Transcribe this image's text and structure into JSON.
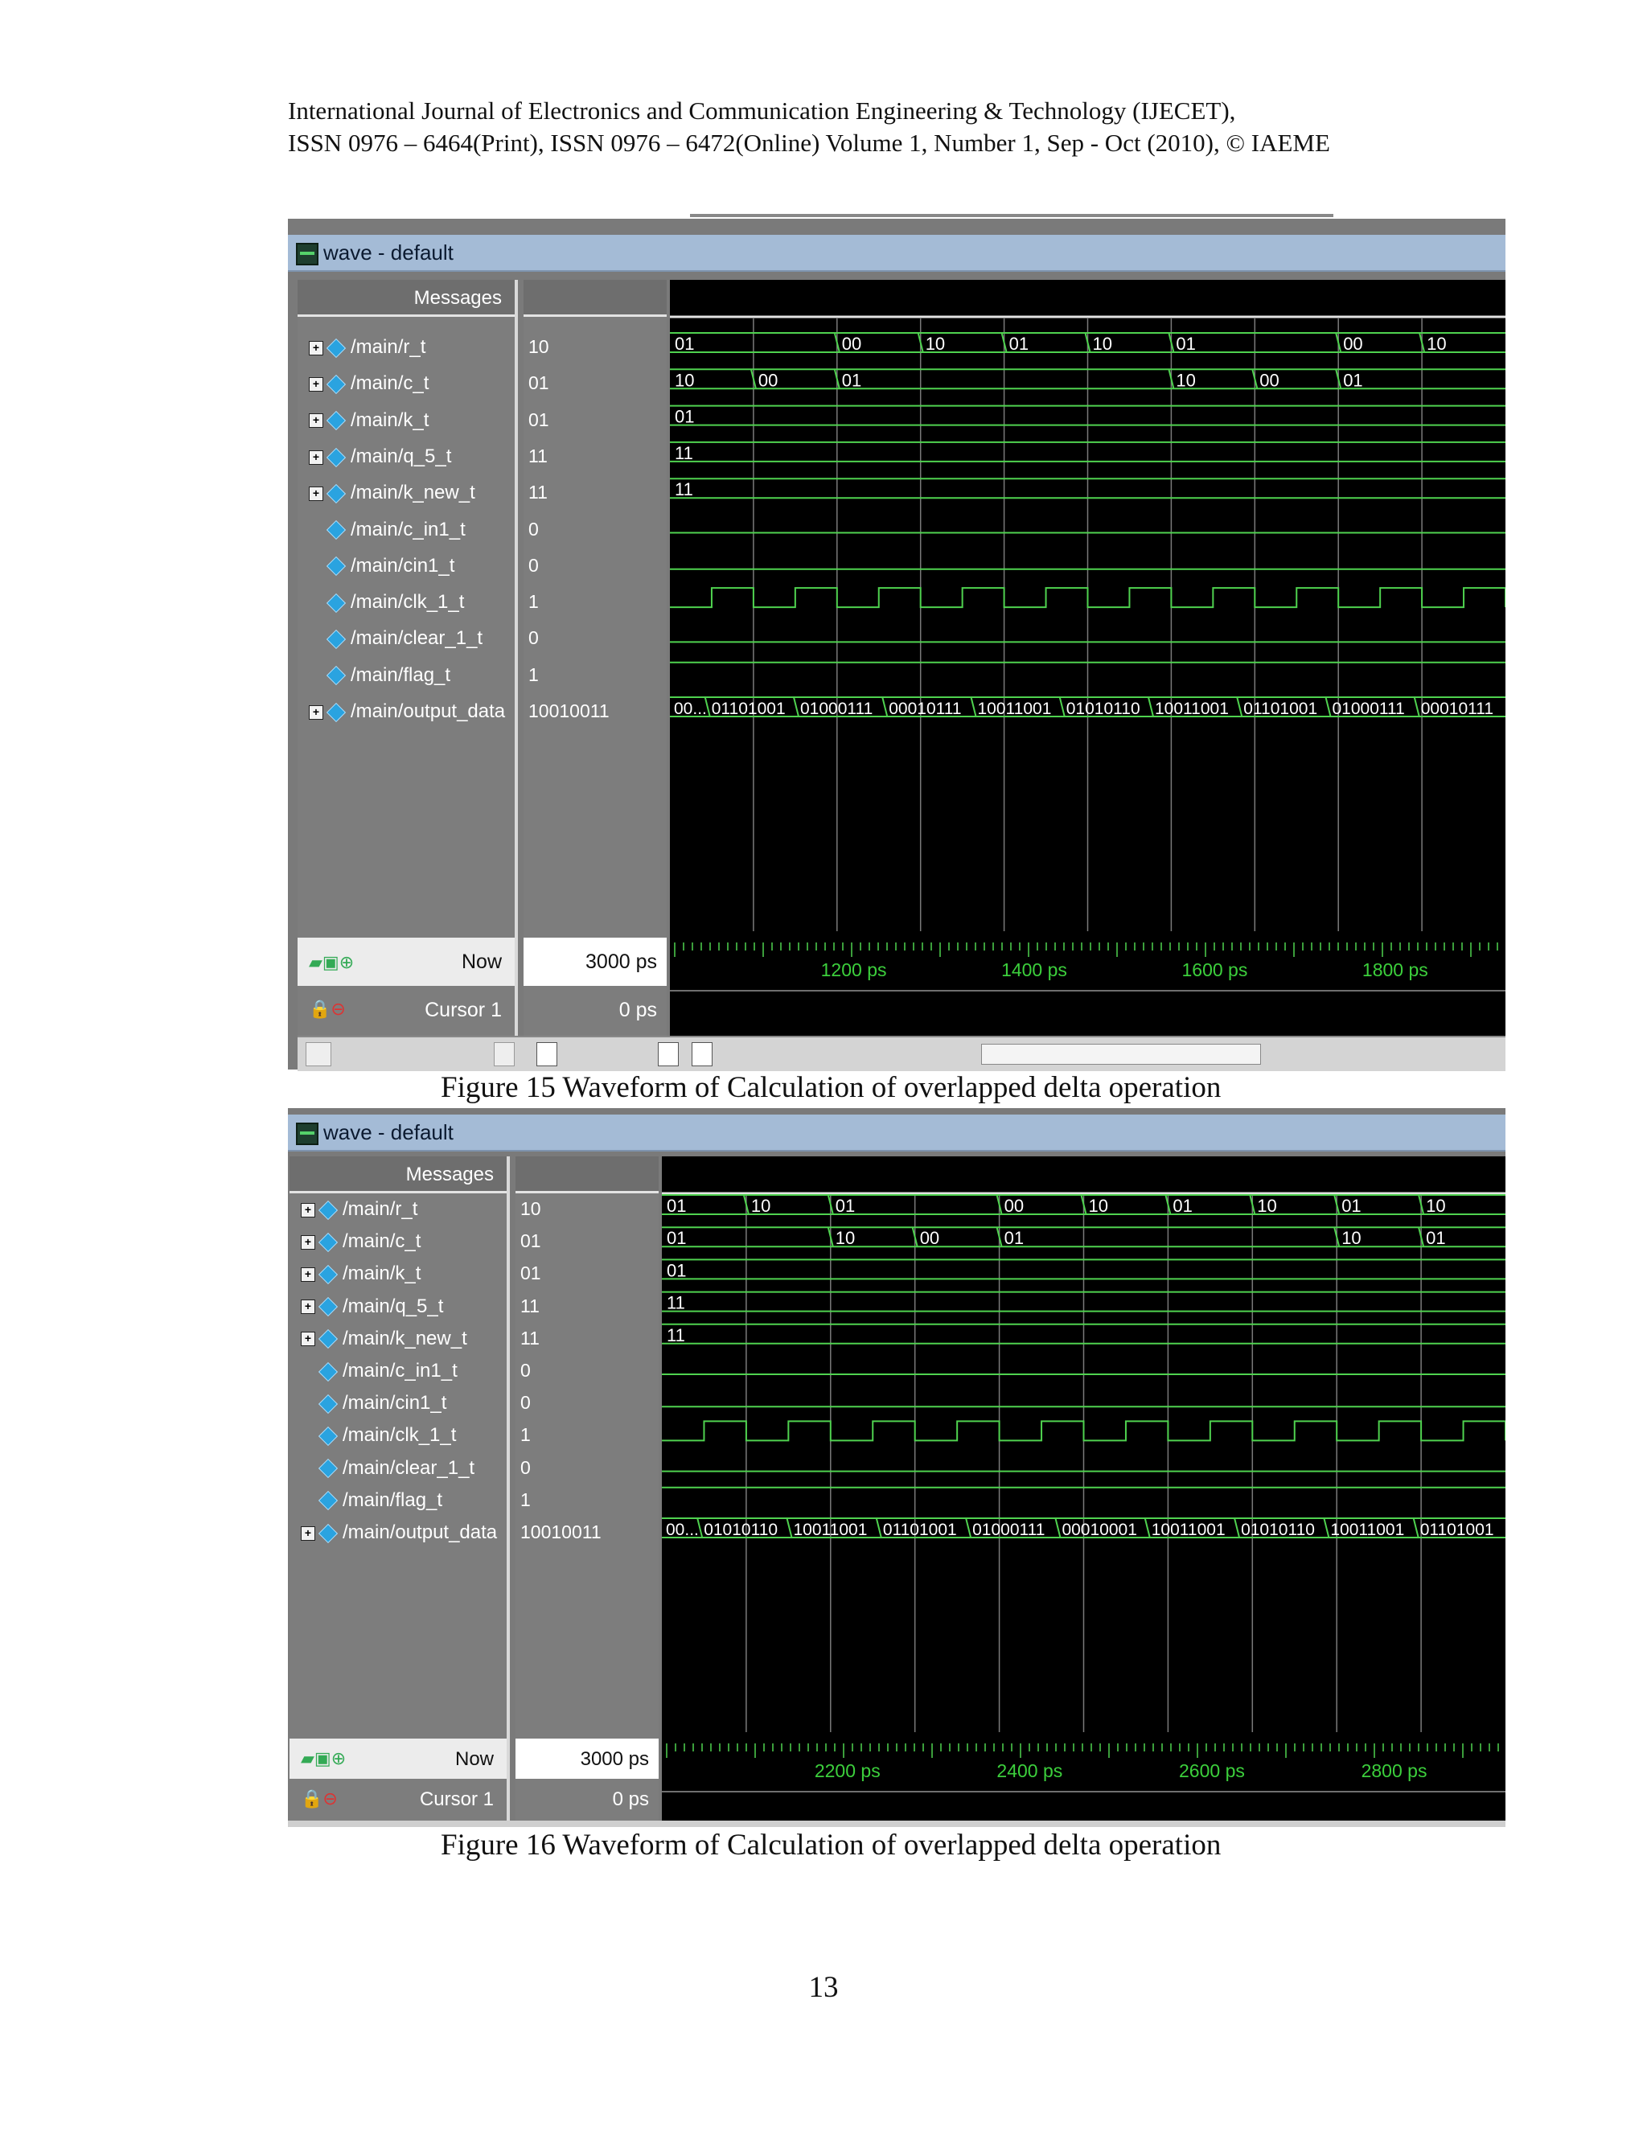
{
  "header": {
    "line1": "International Journal of Electronics and Communication Engineering & Technology (IJECET),",
    "line2": "ISSN 0976 – 6464(Print), ISSN 0976 – 6472(Online) Volume 1, Number 1, Sep - Oct (2010), © IAEME"
  },
  "figures": [
    {
      "window_title": "wave - default",
      "messages_label": "Messages",
      "signals": [
        {
          "name": "/main/r_t",
          "value": "10",
          "expandable": true
        },
        {
          "name": "/main/c_t",
          "value": "01",
          "expandable": true
        },
        {
          "name": "/main/k_t",
          "value": "01",
          "expandable": true
        },
        {
          "name": "/main/q_5_t",
          "value": "11",
          "expandable": true
        },
        {
          "name": "/main/k_new_t",
          "value": "11",
          "expandable": true
        },
        {
          "name": "/main/c_in1_t",
          "value": "0",
          "expandable": false
        },
        {
          "name": "/main/cin1_t",
          "value": "0",
          "expandable": false
        },
        {
          "name": "/main/clk_1_t",
          "value": "1",
          "expandable": false
        },
        {
          "name": "/main/clear_1_t",
          "value": "0",
          "expandable": false
        },
        {
          "name": "/main/flag_t",
          "value": "1",
          "expandable": false
        },
        {
          "name": "/main/output_data",
          "value": "10010011",
          "expandable": true
        }
      ],
      "bus_segments": {
        "r_t": [
          "01",
          "",
          "00",
          "10",
          "01",
          "10",
          "01",
          "",
          "00",
          "10"
        ],
        "c_t": [
          "10",
          "00",
          "01",
          "",
          "",
          "",
          "10",
          "00",
          "01",
          ""
        ],
        "k_t": [
          "01"
        ],
        "q_5_t": [
          "11"
        ],
        "k_new_t": [
          "11"
        ],
        "output_data": [
          "00...",
          "01101001",
          "01000111",
          "00010111",
          "10011001",
          "01010110",
          "10011001",
          "01101001",
          "01000111",
          "00010111"
        ]
      },
      "now_label": "Now",
      "now_value": "3000 ps",
      "cursor_label": "Cursor 1",
      "cursor_value": "0 ps",
      "time_ticks": [
        "1200 ps",
        "1400 ps",
        "1600 ps",
        "1800 ps"
      ],
      "caption": "Figure 15 Waveform of Calculation of overlapped delta operation"
    },
    {
      "window_title": "wave - default",
      "messages_label": "Messages",
      "signals": [
        {
          "name": "/main/r_t",
          "value": "10",
          "expandable": true
        },
        {
          "name": "/main/c_t",
          "value": "01",
          "expandable": true
        },
        {
          "name": "/main/k_t",
          "value": "01",
          "expandable": true
        },
        {
          "name": "/main/q_5_t",
          "value": "11",
          "expandable": true
        },
        {
          "name": "/main/k_new_t",
          "value": "11",
          "expandable": true
        },
        {
          "name": "/main/c_in1_t",
          "value": "0",
          "expandable": false
        },
        {
          "name": "/main/cin1_t",
          "value": "0",
          "expandable": false
        },
        {
          "name": "/main/clk_1_t",
          "value": "1",
          "expandable": false
        },
        {
          "name": "/main/clear_1_t",
          "value": "0",
          "expandable": false
        },
        {
          "name": "/main/flag_t",
          "value": "1",
          "expandable": false
        },
        {
          "name": "/main/output_data",
          "value": "10010011",
          "expandable": true
        }
      ],
      "bus_segments": {
        "r_t": [
          "01",
          "10",
          "01",
          "",
          "00",
          "10",
          "01",
          "10",
          "01",
          "10"
        ],
        "c_t": [
          "01",
          "",
          "10",
          "00",
          "01",
          "",
          "",
          "",
          "10",
          "01"
        ],
        "k_t": [
          "01"
        ],
        "q_5_t": [
          "11"
        ],
        "k_new_t": [
          "11"
        ],
        "output_data": [
          "00...",
          "01010110",
          "10011001",
          "01101001",
          "01000111",
          "00010001",
          "10011001",
          "01010110",
          "10011001",
          "01101001"
        ]
      },
      "now_label": "Now",
      "now_value": "3000 ps",
      "cursor_label": "Cursor 1",
      "cursor_value": "0 ps",
      "time_ticks": [
        "2200 ps",
        "2400 ps",
        "2600 ps",
        "2800 ps"
      ],
      "caption": "Figure 16 Waveform of Calculation of overlapped delta operation"
    }
  ],
  "page_number": "13",
  "colors": {
    "wave_green": "#4fd24f",
    "wave_bg": "#000000",
    "panel_gray": "#7d7d7d",
    "title_bar": "#a4bbd6",
    "timeline_text": "#3ccf3c"
  }
}
